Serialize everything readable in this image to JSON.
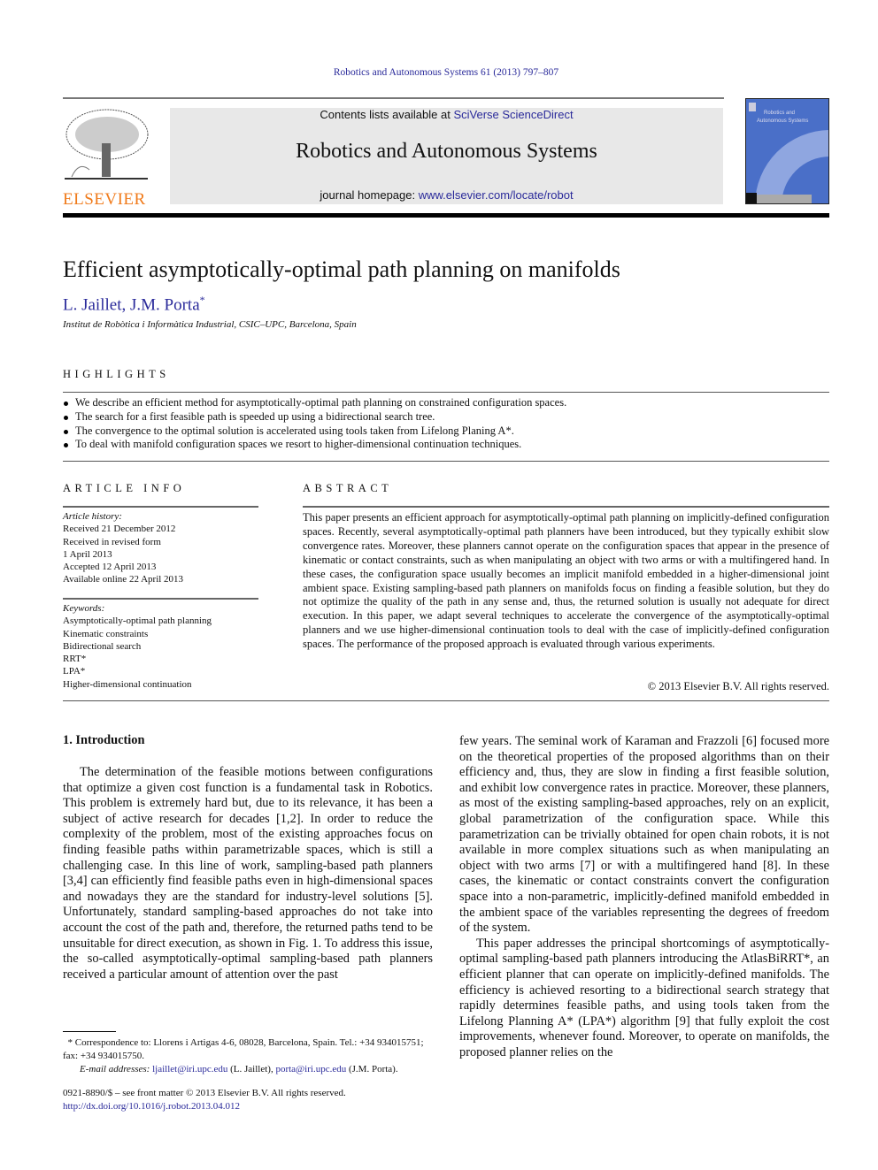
{
  "header": {
    "journal_ref": "Robotics and Autonomous Systems 61 (2013) 797–807",
    "contents_prefix": "Contents lists available at ",
    "contents_link": "SciVerse ScienceDirect",
    "journal_title": "Robotics and Autonomous Systems",
    "homepage_prefix": "journal homepage: ",
    "homepage_link": "www.elsevier.com/locate/robot",
    "publisher_logo": "ELSEVIER",
    "cover_title": "Robotics and Autonomous Systems"
  },
  "article": {
    "title": "Efficient asymptotically-optimal path planning on manifolds",
    "authors": "L. Jaillet, J.M. Porta",
    "author_mark": "*",
    "affiliation": "Institut de Robòtica i Informàtica Industrial, CSIC–UPC, Barcelona, Spain"
  },
  "highlights": {
    "heading": "HIGHLIGHTS",
    "items": [
      "We describe an efficient method for asymptotically-optimal path planning on constrained configuration spaces.",
      "The search for a first feasible path is speeded up using a bidirectional search tree.",
      "The convergence to the optimal solution is accelerated using tools taken from Lifelong Planing A*.",
      "To deal with manifold configuration spaces we resort to higher-dimensional continuation techniques."
    ]
  },
  "article_info": {
    "heading": "ARTICLE INFO",
    "history_label": "Article history:",
    "history": [
      "Received 21 December 2012",
      "Received in revised form",
      "1 April 2013",
      "Accepted 12 April 2013",
      "Available online 22 April 2013"
    ],
    "keywords_label": "Keywords:",
    "keywords": [
      "Asymptotically-optimal path planning",
      "Kinematic constraints",
      "Bidirectional search",
      "RRT*",
      "LPA*",
      "Higher-dimensional continuation"
    ]
  },
  "abstract": {
    "heading": "ABSTRACT",
    "text": "This paper presents an efficient approach for asymptotically-optimal path planning on implicitly-defined configuration spaces. Recently, several asymptotically-optimal path planners have been introduced, but they typically exhibit slow convergence rates. Moreover, these planners cannot operate on the configuration spaces that appear in the presence of kinematic or contact constraints, such as when manipulating an object with two arms or with a multifingered hand. In these cases, the configuration space usually becomes an implicit manifold embedded in a higher-dimensional joint ambient space. Existing sampling-based path planners on manifolds focus on finding a feasible solution, but they do not optimize the quality of the path in any sense and, thus, the returned solution is usually not adequate for direct execution. In this paper, we adapt several techniques to accelerate the convergence of the asymptotically-optimal planners and we use higher-dimensional continuation tools to deal with the case of implicitly-defined configuration spaces. The performance of the proposed approach is evaluated through various experiments.",
    "copyright": "© 2013 Elsevier B.V. All rights reserved."
  },
  "body": {
    "section_heading": "1.  Introduction",
    "left_paragraph": "The determination of the feasible motions between configurations that optimize a given cost function is a fundamental task in Robotics. This problem is extremely hard but, due to its relevance, it has been a subject of active research for decades [1,2]. In order to reduce the complexity of the problem, most of the existing approaches focus on finding feasible paths within parametrizable spaces, which is still a challenging case. In this line of work, sampling-based path planners [3,4] can efficiently find feasible paths even in high-dimensional spaces and nowadays they are the standard for industry-level solutions [5]. Unfortunately, standard sampling-based approaches do not take into account the cost of the path and, therefore, the returned paths tend to be unsuitable for direct execution, as shown in Fig. 1. To address this issue, the so-called asymptotically-optimal sampling-based path planners received a particular amount of attention over the past",
    "right_paragraph_1": "few years. The seminal work of Karaman and Frazzoli [6] focused more on the theoretical properties of the proposed algorithms than on their efficiency and, thus, they are slow in finding a first feasible solution, and exhibit low convergence rates in practice. Moreover, these planners, as most of the existing sampling-based approaches, rely on an explicit, global parametrization of the configuration space. While this parametrization can be trivially obtained for open chain robots, it is not available in more complex situations such as when manipulating an object with two arms [7] or with a multifingered hand [8]. In these cases, the kinematic or contact constraints convert the configuration space into a non-parametric, implicitly-defined manifold embedded in the ambient space of the variables representing the degrees of freedom of the system.",
    "right_paragraph_2": "This paper addresses the principal shortcomings of asymptotically-optimal sampling-based path planners introducing the AtlasBiRRT*, an efficient planner that can operate on implicitly-defined manifolds. The efficiency is achieved resorting to a bidirectional search strategy that rapidly determines feasible paths, and using tools taken from the Lifelong Planning A* (LPA*) algorithm [9] that fully exploit the cost improvements, whenever found. Moreover, to operate on manifolds, the proposed planner relies on the"
  },
  "footnote": {
    "mark": "*",
    "correspondence": "Correspondence to: Llorens i Artigas 4-6, 08028, Barcelona, Spain. Tel.: +34 934015751; fax: +34 934015750.",
    "email_label": "E-mail addresses:",
    "email_1": "ljaillet@iri.upc.edu",
    "email_1_name": "(L. Jaillet),",
    "email_2": "porta@iri.upc.edu",
    "email_2_name": "(J.M. Porta)."
  },
  "front_matter": {
    "issn_line": "0921-8890/$ – see front matter © 2013 Elsevier B.V. All rights reserved.",
    "doi": "http://dx.doi.org/10.1016/j.robot.2013.04.012"
  },
  "colors": {
    "link": "#2a2a9a",
    "elsevier_orange": "#f07a1a",
    "banner_gray": "#e8e8e8",
    "cover_blue": "#4a6fc8"
  }
}
